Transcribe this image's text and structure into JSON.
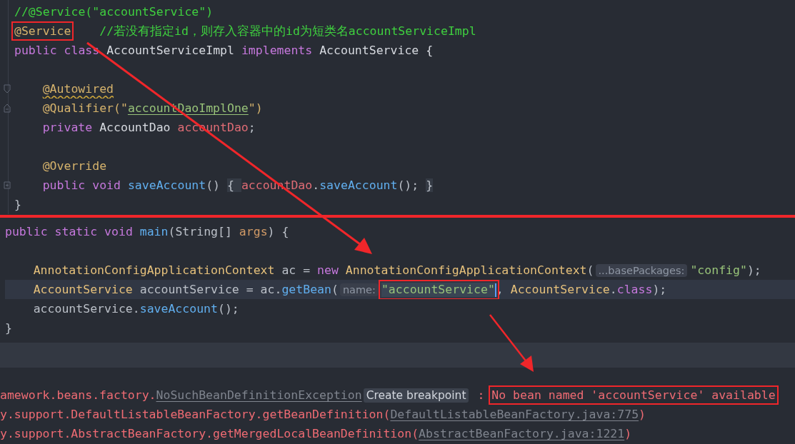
{
  "editor_top": {
    "lines": [
      {
        "kind": "code",
        "indented": false,
        "tokens": [
          {
            "text": "//@Service(\"accountService\")",
            "kind": "comment"
          }
        ]
      },
      {
        "kind": "code",
        "indented": false,
        "tokens": [
          {
            "text": "@Service",
            "kind": "annotation",
            "boxed": true
          },
          {
            "text": "    //若没有指定id，则存入容器中的id为短类名accountServiceImpl",
            "kind": "comment"
          }
        ]
      },
      {
        "kind": "code",
        "indented": false,
        "tokens": [
          {
            "text": "public class ",
            "kind": "keyword"
          },
          {
            "text": "AccountServiceImpl ",
            "kind": "classname"
          },
          {
            "text": "implements ",
            "kind": "keyword"
          },
          {
            "text": "AccountService {",
            "kind": "classname"
          }
        ]
      },
      {
        "kind": "blank"
      },
      {
        "kind": "foldstart",
        "indented": true,
        "tokens": [
          {
            "text": "@Autowired",
            "kind": "annotation",
            "warning": true
          }
        ]
      },
      {
        "kind": "foldend",
        "indented": true,
        "tokens": [
          {
            "text": "@Qualifier(\"",
            "kind": "annotation"
          },
          {
            "text": "accountDaoImplOne",
            "kind": "string",
            "underline": true
          },
          {
            "text": "\")",
            "kind": "annotation"
          }
        ]
      },
      {
        "kind": "code",
        "indented": true,
        "tokens": [
          {
            "text": "private ",
            "kind": "keyword"
          },
          {
            "text": "AccountDao ",
            "kind": "classname"
          },
          {
            "text": "accountDao",
            "kind": "field"
          },
          {
            "text": ";",
            "kind": "plain"
          }
        ]
      },
      {
        "kind": "blank"
      },
      {
        "kind": "code",
        "indented": true,
        "tokens": [
          {
            "text": "@Override",
            "kind": "annotation"
          }
        ]
      },
      {
        "kind": "folded",
        "indented": true,
        "tokens": [
          {
            "text": "public void ",
            "kind": "keyword"
          },
          {
            "text": "saveAccount",
            "kind": "method"
          },
          {
            "text": "() ",
            "kind": "plain"
          },
          {
            "text": "{ ",
            "kind": "fold"
          },
          {
            "text": "accountDao",
            "kind": "field"
          },
          {
            "text": ".",
            "kind": "plain"
          },
          {
            "text": "saveAccount",
            "kind": "method"
          },
          {
            "text": "(); ",
            "kind": "plain"
          },
          {
            "text": "}",
            "kind": "fold"
          }
        ]
      },
      {
        "kind": "code",
        "indented": false,
        "tokens": [
          {
            "text": "}",
            "kind": "plain"
          }
        ]
      }
    ]
  },
  "editor_bottom": {
    "lines": [
      {
        "current": false,
        "indented": false,
        "tokens": [
          {
            "text": "public static void ",
            "kind": "keyword"
          },
          {
            "text": "main",
            "kind": "method"
          },
          {
            "text": "(String[] ",
            "kind": "plain"
          },
          {
            "text": "args",
            "kind": "param"
          },
          {
            "text": ") {",
            "kind": "plain"
          }
        ]
      },
      {
        "current": false
      },
      {
        "current": false,
        "indented": true,
        "tokens": [
          {
            "text": "AnnotationConfigApplicationContext ",
            "kind": "type"
          },
          {
            "text": "ac = ",
            "kind": "plain"
          },
          {
            "text": "new ",
            "kind": "keyword"
          },
          {
            "text": "AnnotationConfigApplicationContext",
            "kind": "type"
          },
          {
            "text": "(",
            "kind": "plain"
          },
          {
            "text": "...basePackages:",
            "kind": "hint"
          },
          {
            "text": "\"config\"",
            "kind": "string"
          },
          {
            "text": ");",
            "kind": "plain"
          }
        ]
      },
      {
        "current": true,
        "indented": true,
        "tokens": [
          {
            "text": "AccountService ",
            "kind": "type"
          },
          {
            "text": "accountService = ac.",
            "kind": "plain"
          },
          {
            "text": "getBean",
            "kind": "method"
          },
          {
            "text": "(",
            "kind": "plain"
          },
          {
            "text": "name:",
            "kind": "hint"
          },
          {
            "text": "\"accountService\"",
            "kind": "string",
            "boxed": true,
            "caret": true
          },
          {
            "text": ", ",
            "kind": "plain"
          },
          {
            "text": "AccountService",
            "kind": "type"
          },
          {
            "text": ".",
            "kind": "plain"
          },
          {
            "text": "class",
            "kind": "keyword"
          },
          {
            "text": ");",
            "kind": "plain"
          }
        ]
      },
      {
        "current": false,
        "indented": true,
        "tokens": [
          {
            "text": "accountService.",
            "kind": "plain"
          },
          {
            "text": "saveAccount",
            "kind": "method"
          },
          {
            "text": "();",
            "kind": "plain"
          }
        ]
      },
      {
        "current": false,
        "indented": false,
        "tokens": [
          {
            "text": "}",
            "kind": "plain"
          }
        ]
      }
    ]
  },
  "console": {
    "lines": [
      {
        "tokens": [
          {
            "text": "amework.beans.factory.",
            "kind": "error"
          },
          {
            "text": "NoSuchBeanDefinitionException",
            "kind": "link"
          },
          {
            "text": "Create breakpoint",
            "kind": "badge"
          },
          {
            "text": " : ",
            "kind": "error"
          },
          {
            "text": "No bean named 'accountService' available",
            "kind": "error",
            "boxed": true
          }
        ]
      },
      {
        "tokens": [
          {
            "text": "y.support.DefaultListableBeanFactory.getBeanDefinition(",
            "kind": "error"
          },
          {
            "text": "DefaultListableBeanFactory.java:775",
            "kind": "link"
          },
          {
            "text": ")",
            "kind": "error"
          }
        ]
      },
      {
        "tokens": [
          {
            "text": "y.support.AbstractBeanFactory.getMergedLocalBeanDefinition(",
            "kind": "error"
          },
          {
            "text": "AbstractBeanFactory.java:1221",
            "kind": "link"
          },
          {
            "text": ")",
            "kind": "error"
          }
        ]
      }
    ]
  }
}
